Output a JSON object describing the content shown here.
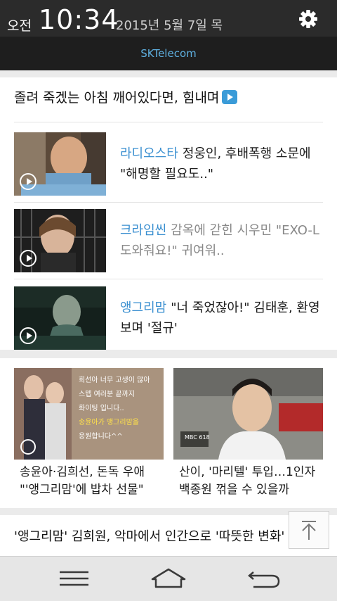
{
  "status_bar": {
    "ampm": "오전",
    "time": "10:34",
    "date": "2015년 5월 7일 목",
    "settings_icon": "gear-icon"
  },
  "carrier": "SKTelecom",
  "headline": {
    "text": "졸려 죽겠는 아침 깨어있다면, 힘내며",
    "icon": "play-badge-icon"
  },
  "video_items": [
    {
      "category": "라디오스타",
      "title": "정웅인, 후배폭행 소문에 \"해명할 필요도..\"",
      "read": false,
      "thumb_icon": "play-circle-icon"
    },
    {
      "category": "크라임씬",
      "title": "감옥에 갇힌 시우민 \"EXO-L 도와줘요!\" 귀여워..",
      "read": true,
      "thumb_icon": "play-circle-icon"
    },
    {
      "category": "앵그리맘",
      "title": "\"너 죽었잖아!\" 김태훈, 환영 보며 '절규'",
      "read": false,
      "thumb_icon": "play-circle-icon"
    }
  ],
  "grid_items": [
    {
      "caption": "송윤아·김희선, 돈독 우애 \"'앵그리맘'에 밥차 선물\"",
      "overlay_text": [
        "희선아 너무 고생이 많아",
        "스텝 여러분 끝까지",
        "화이팅 입니다..",
        "송윤아가 앵그리맘을",
        "응원합니다^^"
      ],
      "gallery_icon": "gallery-icon"
    },
    {
      "caption": "산이, '마리텔' 투입…1인자 백종원 꺾을 수 있을까",
      "badge_text": "MBC 618"
    }
  ],
  "bottom_headline": "'앵그리맘' 김희원, 악마에서 인간으로 '따뜻한 변화'",
  "scroll_top_icon": "arrow-up-icon",
  "nav": {
    "menu_icon": "menu-icon",
    "home_icon": "home-icon",
    "back_icon": "back-icon"
  },
  "colors": {
    "accent": "#3a8fd0",
    "carrier_text": "#5fb0e0",
    "status_bar_bg": "#2b2b2b"
  }
}
